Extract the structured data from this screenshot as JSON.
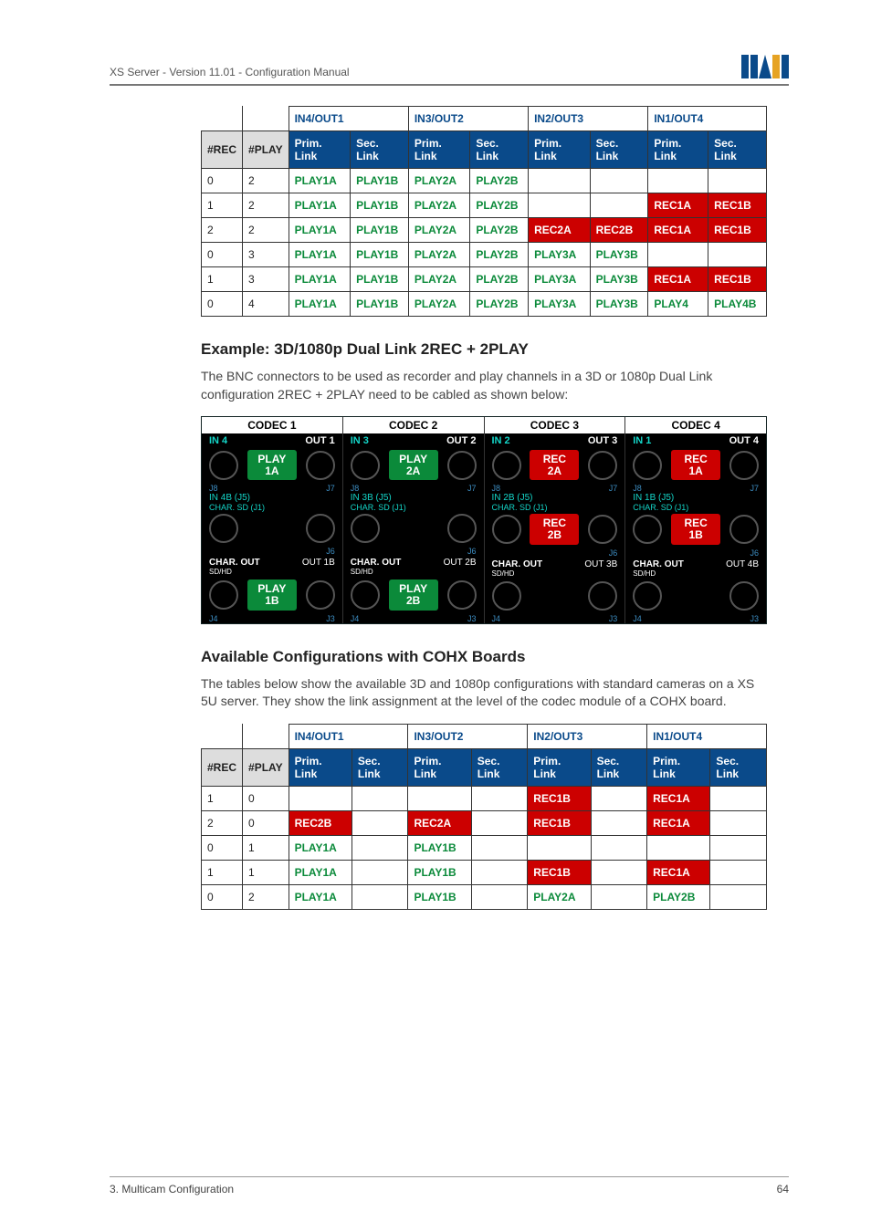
{
  "header": {
    "left": "XS Server - Version 11.01 - Configuration Manual",
    "logo_alt": "EVS"
  },
  "footer": {
    "left": "3. Multicam Configuration",
    "right": "64"
  },
  "table1": {
    "group_headers": [
      "IN4/OUT1",
      "IN3/OUT2",
      "IN2/OUT3",
      "IN1/OUT4"
    ],
    "sub_headers": [
      "#REC",
      "#PLAY",
      "Prim. Link",
      "Sec. Link",
      "Prim. Link",
      "Sec. Link",
      "Prim. Link",
      "Sec. Link",
      "Prim. Link",
      "Sec. Link"
    ],
    "rows": [
      {
        "rec": "0",
        "play": "2",
        "cells": [
          {
            "t": "PLAY1A",
            "c": "play"
          },
          {
            "t": "PLAY1B",
            "c": "play"
          },
          {
            "t": "PLAY2A",
            "c": "play"
          },
          {
            "t": "PLAY2B",
            "c": "play"
          },
          {
            "t": "",
            "c": "empty"
          },
          {
            "t": "",
            "c": "empty"
          },
          {
            "t": "",
            "c": "empty"
          },
          {
            "t": "",
            "c": "empty"
          }
        ]
      },
      {
        "rec": "1",
        "play": "2",
        "cells": [
          {
            "t": "PLAY1A",
            "c": "play"
          },
          {
            "t": "PLAY1B",
            "c": "play"
          },
          {
            "t": "PLAY2A",
            "c": "play"
          },
          {
            "t": "PLAY2B",
            "c": "play"
          },
          {
            "t": "",
            "c": "empty"
          },
          {
            "t": "",
            "c": "empty"
          },
          {
            "t": "REC1A",
            "c": "rec"
          },
          {
            "t": "REC1B",
            "c": "rec"
          }
        ]
      },
      {
        "rec": "2",
        "play": "2",
        "cells": [
          {
            "t": "PLAY1A",
            "c": "play"
          },
          {
            "t": "PLAY1B",
            "c": "play"
          },
          {
            "t": "PLAY2A",
            "c": "play"
          },
          {
            "t": "PLAY2B",
            "c": "play"
          },
          {
            "t": "REC2A",
            "c": "rec"
          },
          {
            "t": "REC2B",
            "c": "rec"
          },
          {
            "t": "REC1A",
            "c": "rec"
          },
          {
            "t": "REC1B",
            "c": "rec"
          }
        ]
      },
      {
        "rec": "0",
        "play": "3",
        "cells": [
          {
            "t": "PLAY1A",
            "c": "play"
          },
          {
            "t": "PLAY1B",
            "c": "play"
          },
          {
            "t": "PLAY2A",
            "c": "play"
          },
          {
            "t": "PLAY2B",
            "c": "play"
          },
          {
            "t": "PLAY3A",
            "c": "play"
          },
          {
            "t": "PLAY3B",
            "c": "play"
          },
          {
            "t": "",
            "c": "empty"
          },
          {
            "t": "",
            "c": "empty"
          }
        ]
      },
      {
        "rec": "1",
        "play": "3",
        "cells": [
          {
            "t": "PLAY1A",
            "c": "play"
          },
          {
            "t": "PLAY1B",
            "c": "play"
          },
          {
            "t": "PLAY2A",
            "c": "play"
          },
          {
            "t": "PLAY2B",
            "c": "play"
          },
          {
            "t": "PLAY3A",
            "c": "play"
          },
          {
            "t": "PLAY3B",
            "c": "play"
          },
          {
            "t": "REC1A",
            "c": "rec"
          },
          {
            "t": "REC1B",
            "c": "rec"
          }
        ]
      },
      {
        "rec": "0",
        "play": "4",
        "cells": [
          {
            "t": "PLAY1A",
            "c": "play"
          },
          {
            "t": "PLAY1B",
            "c": "play"
          },
          {
            "t": "PLAY2A",
            "c": "play"
          },
          {
            "t": "PLAY2B",
            "c": "play"
          },
          {
            "t": "PLAY3A",
            "c": "play"
          },
          {
            "t": "PLAY3B",
            "c": "play"
          },
          {
            "t": "PLAY4",
            "c": "play"
          },
          {
            "t": "PLAY4B",
            "c": "play"
          }
        ]
      }
    ]
  },
  "section1": {
    "title": "Example: 3D/1080p Dual Link 2REC + 2PLAY",
    "body": "The BNC connectors to be used as recorder and play channels in a 3D or 1080p Dual Link configuration 2REC + 2PLAY need to be cabled as shown below:"
  },
  "diagram": {
    "codecs": [
      {
        "title": "CODEC 1",
        "in": "IN 4",
        "out": "OUT 1",
        "tag1": {
          "t": "PLAY\n1A",
          "c": "play"
        },
        "mid_in": "IN 4B (J5)",
        "mid_sub": "CHAR. SD (J1)",
        "tag2": null,
        "char": "CHAR. OUT",
        "char_sub": "SD/HD",
        "outb": "OUT 1B",
        "tag3": {
          "t": "PLAY\n1B",
          "c": "play"
        },
        "jL": "J4",
        "jR": "J3"
      },
      {
        "title": "CODEC 2",
        "in": "IN 3",
        "out": "OUT 2",
        "tag1": {
          "t": "PLAY\n2A",
          "c": "play"
        },
        "mid_in": "IN 3B (J5)",
        "mid_sub": "CHAR. SD (J1)",
        "tag2": null,
        "char": "CHAR. OUT",
        "char_sub": "SD/HD",
        "outb": "OUT 2B",
        "tag3": {
          "t": "PLAY\n2B",
          "c": "play"
        },
        "jL": "J4",
        "jR": "J3"
      },
      {
        "title": "CODEC 3",
        "in": "IN 2",
        "out": "OUT 3",
        "tag1": {
          "t": "REC\n2A",
          "c": "rec"
        },
        "mid_in": "IN 2B (J5)",
        "mid_sub": "CHAR. SD (J1)",
        "tag2": {
          "t": "REC\n2B",
          "c": "rec"
        },
        "char": "CHAR. OUT",
        "char_sub": "SD/HD",
        "outb": "OUT 3B",
        "tag3": null,
        "jL": "J4",
        "jR": "J3"
      },
      {
        "title": "CODEC 4",
        "in": "IN 1",
        "out": "OUT 4",
        "tag1": {
          "t": "REC\n1A",
          "c": "rec"
        },
        "mid_in": "IN 1B (J5)",
        "mid_sub": "CHAR. SD (J1)",
        "tag2": {
          "t": "REC\n1B",
          "c": "rec"
        },
        "char": "CHAR. OUT",
        "char_sub": "SD/HD",
        "outb": "OUT 4B",
        "tag3": null,
        "jL": "J4",
        "jR": "J3"
      }
    ],
    "j_top": [
      "J8",
      "J7"
    ],
    "j_mid": [
      "",
      "J6"
    ]
  },
  "section2": {
    "title": "Available Configurations with COHX Boards",
    "body": "The tables below show the available 3D and 1080p configurations with standard cameras on a XS 5U server. They show the link assignment at the level of the codec module of a COHX board."
  },
  "table2": {
    "group_headers": [
      "IN4/OUT1",
      "IN3/OUT2",
      "IN2/OUT3",
      "IN1/OUT4"
    ],
    "sub_headers": [
      "#REC",
      "#PLAY",
      "Prim. Link",
      "Sec. Link",
      "Prim. Link",
      "Sec. Link",
      "Prim. Link",
      "Sec. Link",
      "Prim. Link",
      "Sec. Link"
    ],
    "rows": [
      {
        "rec": "1",
        "play": "0",
        "cells": [
          {
            "t": "",
            "c": "empty"
          },
          {
            "t": "",
            "c": "empty"
          },
          {
            "t": "",
            "c": "empty"
          },
          {
            "t": "",
            "c": "empty"
          },
          {
            "t": "REC1B",
            "c": "rec"
          },
          {
            "t": "",
            "c": "empty"
          },
          {
            "t": "REC1A",
            "c": "rec"
          },
          {
            "t": "",
            "c": "empty"
          }
        ]
      },
      {
        "rec": "2",
        "play": "0",
        "cells": [
          {
            "t": "REC2B",
            "c": "rec"
          },
          {
            "t": "",
            "c": "empty"
          },
          {
            "t": "REC2A",
            "c": "rec"
          },
          {
            "t": "",
            "c": "empty"
          },
          {
            "t": "REC1B",
            "c": "rec"
          },
          {
            "t": "",
            "c": "empty"
          },
          {
            "t": "REC1A",
            "c": "rec"
          },
          {
            "t": "",
            "c": "empty"
          }
        ]
      },
      {
        "rec": "0",
        "play": "1",
        "cells": [
          {
            "t": "PLAY1A",
            "c": "play"
          },
          {
            "t": "",
            "c": "empty"
          },
          {
            "t": "PLAY1B",
            "c": "play"
          },
          {
            "t": "",
            "c": "empty"
          },
          {
            "t": "",
            "c": "empty"
          },
          {
            "t": "",
            "c": "empty"
          },
          {
            "t": "",
            "c": "empty"
          },
          {
            "t": "",
            "c": "empty"
          }
        ]
      },
      {
        "rec": "1",
        "play": "1",
        "cells": [
          {
            "t": "PLAY1A",
            "c": "play"
          },
          {
            "t": "",
            "c": "empty"
          },
          {
            "t": "PLAY1B",
            "c": "play"
          },
          {
            "t": "",
            "c": "empty"
          },
          {
            "t": "REC1B",
            "c": "rec"
          },
          {
            "t": "",
            "c": "empty"
          },
          {
            "t": "REC1A",
            "c": "rec"
          },
          {
            "t": "",
            "c": "empty"
          }
        ]
      },
      {
        "rec": "0",
        "play": "2",
        "cells": [
          {
            "t": "PLAY1A",
            "c": "play"
          },
          {
            "t": "",
            "c": "empty"
          },
          {
            "t": "PLAY1B",
            "c": "play"
          },
          {
            "t": "",
            "c": "empty"
          },
          {
            "t": "PLAY2A",
            "c": "play"
          },
          {
            "t": "",
            "c": "empty"
          },
          {
            "t": "PLAY2B",
            "c": "play"
          },
          {
            "t": "",
            "c": "empty"
          }
        ]
      }
    ]
  }
}
